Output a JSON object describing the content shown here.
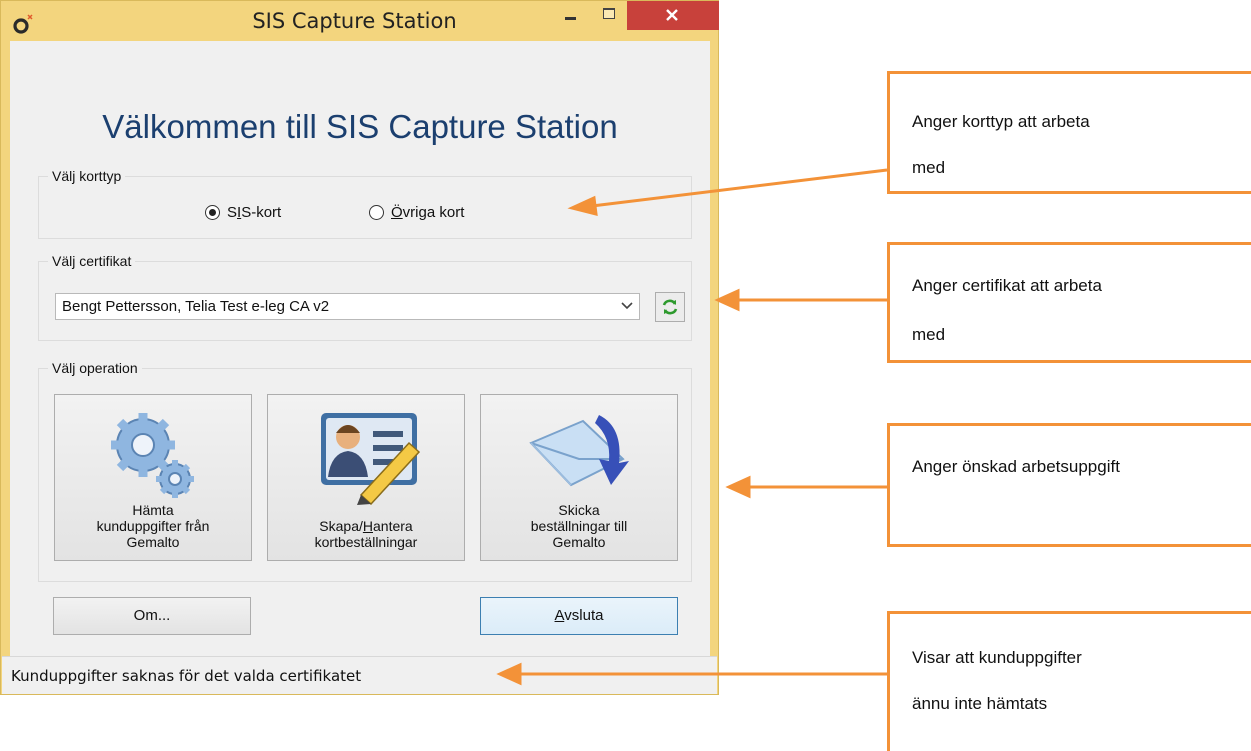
{
  "window": {
    "title": "SIS Capture Station",
    "welcome": "Välkommen till SIS Capture Station",
    "card_type": {
      "legend": "Välj korttyp",
      "options": [
        {
          "label": "SIS-kort",
          "mnemonic": "I",
          "selected": true
        },
        {
          "label": "Övriga kort",
          "mnemonic": "Ö",
          "selected": false
        }
      ]
    },
    "certificate": {
      "legend": "Välj certifikat",
      "selected": "Bengt Pettersson, Telia Test e-leg CA v2"
    },
    "operation": {
      "legend": "Välj operation",
      "buttons": [
        {
          "label": "Hämta\nkunduppgifter från\nGemalto",
          "icon": "gears-icon"
        },
        {
          "label": "Skapa/Hantera\nkortbeställningar",
          "icon": "id-card-pen-icon"
        },
        {
          "label": "Skicka\nbeställningar till\nGemalto",
          "icon": "envelope-arrow-icon"
        }
      ]
    },
    "about_label": "Om...",
    "exit_label": "Avsluta",
    "status": "Kunduppgifter saknas för det valda certifikatet"
  },
  "callouts": [
    {
      "line1": "Anger korttyp att arbeta",
      "line2": "med"
    },
    {
      "line1": "Anger certifikat att arbeta",
      "line2": "med"
    },
    {
      "line1": "Anger önskad arbetsuppgift",
      "line2": ""
    },
    {
      "line1": "Visar att kunduppgifter",
      "line2": "ännu inte hämtats"
    }
  ],
  "colors": {
    "accent": "#f39238",
    "title_bar": "#f3d57e",
    "close": "#c8413b",
    "heading": "#1b3f6f"
  }
}
